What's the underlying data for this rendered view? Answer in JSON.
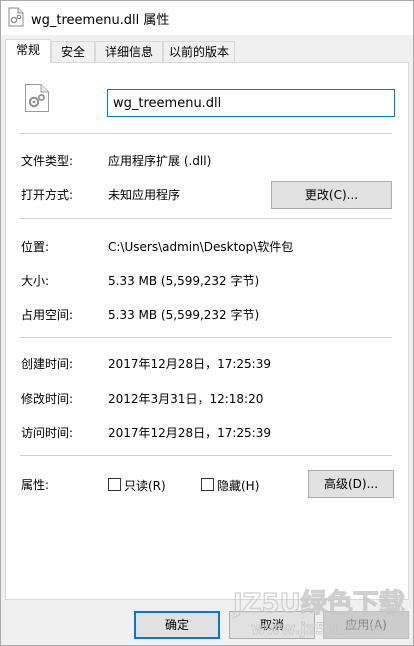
{
  "window": {
    "title": "wg_treemenu.dll 属性"
  },
  "tabs": [
    {
      "label": "常规",
      "active": true
    },
    {
      "label": "安全",
      "active": false
    },
    {
      "label": "详细信息",
      "active": false
    },
    {
      "label": "以前的版本",
      "active": false
    }
  ],
  "general": {
    "file_name": "wg_treemenu.dll",
    "file_type_label": "文件类型:",
    "file_type_value": "应用程序扩展 (.dll)",
    "opens_with_label": "打开方式:",
    "opens_with_value": "未知应用程序",
    "change_button": "更改(C)...",
    "location_label": "位置:",
    "location_value": "C:\\Users\\admin\\Desktop\\软件包",
    "size_label": "大小:",
    "size_value": "5.33 MB (5,599,232 字节)",
    "size_on_disk_label": "占用空间:",
    "size_on_disk_value": "5.33 MB (5,599,232 字节)",
    "created_label": "创建时间:",
    "created_value": "2017年12月28日，17:25:39",
    "modified_label": "修改时间:",
    "modified_value": "2012年3月31日，12:18:20",
    "accessed_label": "访问时间:",
    "accessed_value": "2017年12月28日，17:25:39",
    "attributes_label": "属性:",
    "readonly_label": "只读(R)",
    "readonly_checked": false,
    "hidden_label": "隐藏(H)",
    "hidden_checked": false,
    "advanced_button": "高级(D)..."
  },
  "footer": {
    "ok_button": "确定",
    "cancel_button": "取消",
    "apply_button": "应用(A)",
    "apply_enabled": false
  },
  "watermark": {
    "line1": "JZ5U绿色下载",
    "line2": "www.jz5u.com"
  },
  "colors": {
    "accent": "#0078d7",
    "panel_bg": "#ffffff",
    "chrome_bg": "#f0f0f0",
    "separator": "#d0d0d0"
  },
  "icons": {
    "title": "dll-file-gear-icon",
    "file": "dll-file-gear-icon"
  }
}
